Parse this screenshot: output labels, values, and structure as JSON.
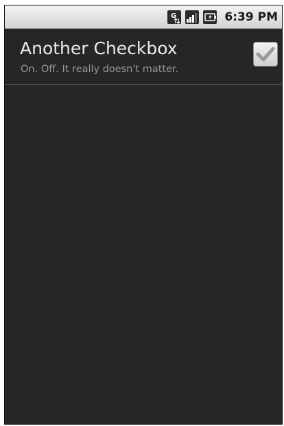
{
  "status_bar": {
    "time": "6:39 PM",
    "icons": [
      "network-type-icon",
      "signal-strength-icon",
      "battery-icon"
    ]
  },
  "preference": {
    "title": "Another Checkbox",
    "summary": "On. Off. It really doesn't matter.",
    "checked": true
  },
  "colors": {
    "background": "#262626",
    "title_text": "#ececec",
    "summary_text": "#9a9a9a",
    "status_bar": "#e0e0e0"
  }
}
